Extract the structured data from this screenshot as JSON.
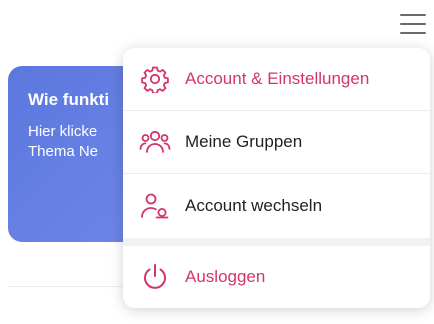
{
  "colors": {
    "accent": "#d43567",
    "card_gradient_start": "#5b78de",
    "card_gradient_end": "#6f86e8",
    "text_dark": "#222222"
  },
  "header": {
    "menu_icon": "hamburger-menu-icon"
  },
  "info_card": {
    "title": "Wie funkti",
    "text_line_1": "Hier klicke",
    "text_line_2": "Thema Ne"
  },
  "dropdown": {
    "items": [
      {
        "label": "Account & Einstellungen",
        "icon": "settings-gear-icon",
        "active": true
      },
      {
        "label": "Meine Gruppen",
        "icon": "group-users-icon",
        "active": false
      },
      {
        "label": "Account wechseln",
        "icon": "switch-account-icon",
        "active": false
      },
      {
        "label": "Ausloggen",
        "icon": "power-icon",
        "active": true
      }
    ]
  }
}
